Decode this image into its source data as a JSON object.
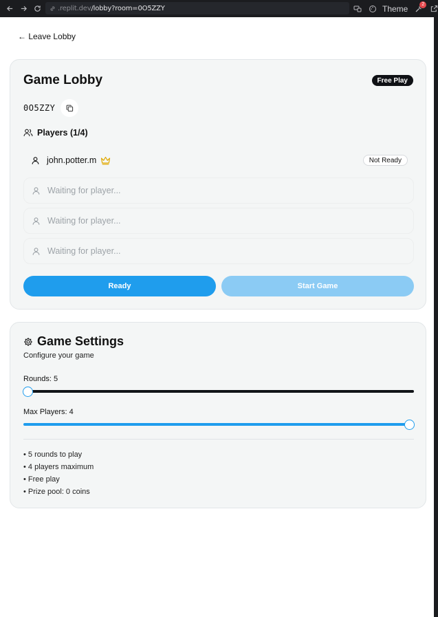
{
  "browser": {
    "url_domain": ".replit.dev",
    "url_path": "/lobby?room=0O5ZZY",
    "theme_label": "Theme",
    "notification_count": "2"
  },
  "nav": {
    "leave_label": "← Leave Lobby"
  },
  "lobby": {
    "title": "Game Lobby",
    "mode_badge": "Free Play",
    "room_code": "0O5ZZY",
    "players_heading": "Players (1/4)",
    "players": [
      {
        "name": "john.potter.m",
        "is_host": true,
        "status": "Not Ready"
      }
    ],
    "empty_slots": [
      "Waiting for player...",
      "Waiting for player...",
      "Waiting for player..."
    ],
    "ready_label": "Ready",
    "start_label": "Start Game"
  },
  "settings": {
    "title": "Game Settings",
    "subtitle": "Configure your game",
    "rounds_label": "Rounds: 5",
    "rounds_level": 0.0,
    "max_players_label": "Max Players: 4",
    "max_players_level": 1.0,
    "summary": [
      "• 5 rounds to play",
      "• 4 players maximum",
      "• Free play",
      "• Prize pool: 0 coins"
    ]
  },
  "colors": {
    "accent": "#1f9ded",
    "accent_disabled": "#8bcbf4",
    "crown": "#e0a800",
    "track_dark": "#111418"
  }
}
